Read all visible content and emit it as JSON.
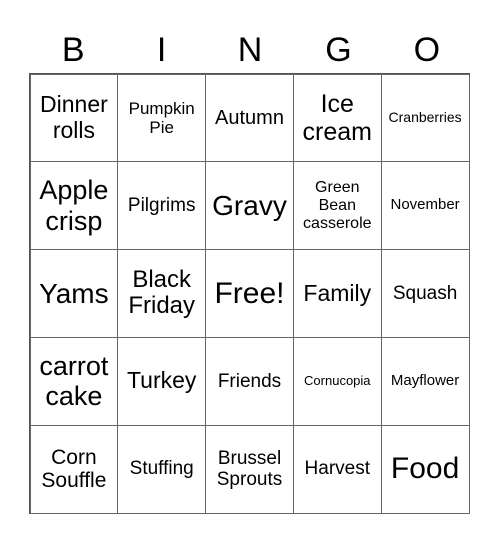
{
  "header": {
    "letters": [
      "B",
      "I",
      "N",
      "G",
      "O"
    ]
  },
  "board": {
    "rows": [
      [
        {
          "text": "Dinner rolls",
          "size": 23
        },
        {
          "text": "Pumpkin Pie",
          "size": 17
        },
        {
          "text": "Autumn",
          "size": 20
        },
        {
          "text": "Ice cream",
          "size": 25
        },
        {
          "text": "Cranberries",
          "size": 14
        }
      ],
      [
        {
          "text": "Apple crisp",
          "size": 27
        },
        {
          "text": "Pilgrims",
          "size": 19
        },
        {
          "text": "Gravy",
          "size": 28
        },
        {
          "text": "Green Bean casserole",
          "size": 16
        },
        {
          "text": "November",
          "size": 15
        }
      ],
      [
        {
          "text": "Yams",
          "size": 28
        },
        {
          "text": "Black Friday",
          "size": 24
        },
        {
          "text": "Free!",
          "size": 30
        },
        {
          "text": "Family",
          "size": 23
        },
        {
          "text": "Squash",
          "size": 19
        }
      ],
      [
        {
          "text": "carrot cake",
          "size": 27
        },
        {
          "text": "Turkey",
          "size": 23
        },
        {
          "text": "Friends",
          "size": 19
        },
        {
          "text": "Cornucopia",
          "size": 13
        },
        {
          "text": "Mayflower",
          "size": 15
        }
      ],
      [
        {
          "text": "Corn Souffle",
          "size": 21
        },
        {
          "text": "Stuffing",
          "size": 19
        },
        {
          "text": "Brussel Sprouts",
          "size": 19
        },
        {
          "text": "Harvest",
          "size": 19
        },
        {
          "text": "Food",
          "size": 30
        }
      ]
    ]
  }
}
